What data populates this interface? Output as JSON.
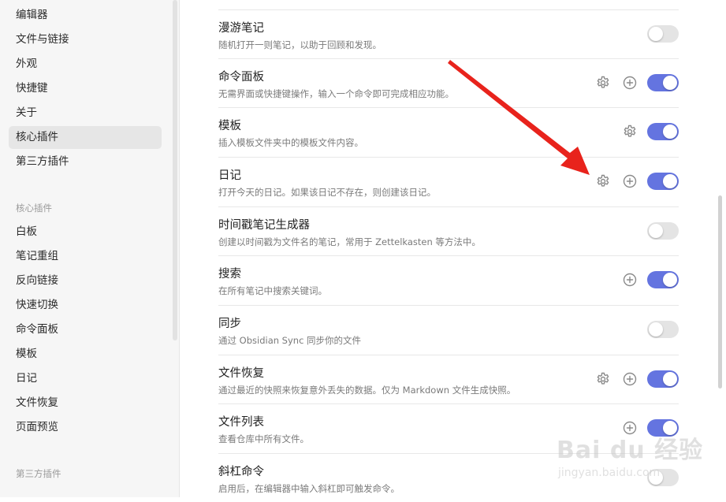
{
  "sidebar": {
    "options": [
      "编辑器",
      "文件与链接",
      "外观",
      "快捷键",
      "关于",
      "核心插件",
      "第三方插件"
    ],
    "active_option": "核心插件",
    "core_plugins_heading": "核心插件",
    "core_plugins": [
      "白板",
      "笔记重组",
      "反向链接",
      "快速切换",
      "命令面板",
      "模板",
      "日记",
      "文件恢复",
      "页面预览"
    ],
    "community_heading": "第三方插件"
  },
  "plugins": [
    {
      "name": "漫游笔记",
      "desc": "随机打开一则笔记，以助于回顾和发现。",
      "enabled": false,
      "gear": false,
      "plus": false
    },
    {
      "name": "命令面板",
      "desc": "无需界面或快捷键操作，输入一个命令即可完成相应功能。",
      "enabled": true,
      "gear": true,
      "plus": true
    },
    {
      "name": "模板",
      "desc": "插入模板文件夹中的模板文件内容。",
      "enabled": true,
      "gear": true,
      "plus": false
    },
    {
      "name": "日记",
      "desc": "打开今天的日记。如果该日记不存在，则创建该日记。",
      "enabled": true,
      "gear": true,
      "plus": true
    },
    {
      "name": "时间戳笔记生成器",
      "desc": "创建以时间戳为文件名的笔记，常用于 Zettelkasten 等方法中。",
      "enabled": false,
      "gear": false,
      "plus": false
    },
    {
      "name": "搜索",
      "desc": "在所有笔记中搜索关键词。",
      "enabled": true,
      "gear": false,
      "plus": true
    },
    {
      "name": "同步",
      "desc": "通过 Obsidian Sync 同步你的文件",
      "enabled": false,
      "gear": false,
      "plus": false
    },
    {
      "name": "文件恢复",
      "desc": "通过最近的快照来恢复意外丢失的数据。仅为 Markdown 文件生成快照。",
      "enabled": true,
      "gear": true,
      "plus": true
    },
    {
      "name": "文件列表",
      "desc": "查看仓库中所有文件。",
      "enabled": true,
      "gear": false,
      "plus": true
    },
    {
      "name": "斜杠命令",
      "desc": "启用后，在编辑器中输入斜杠即可触发命令。",
      "enabled": false,
      "gear": false,
      "plus": false
    }
  ],
  "icons": {
    "settings": "gear-icon",
    "add_hotkey": "plus-circle-icon"
  },
  "colors": {
    "accent": "#6474e0",
    "toggle_off": "#e4e4e4",
    "arrow": "#e8231c"
  },
  "watermark": {
    "brand": "Bai du 经验",
    "url": "jingyan.baidu.com"
  }
}
